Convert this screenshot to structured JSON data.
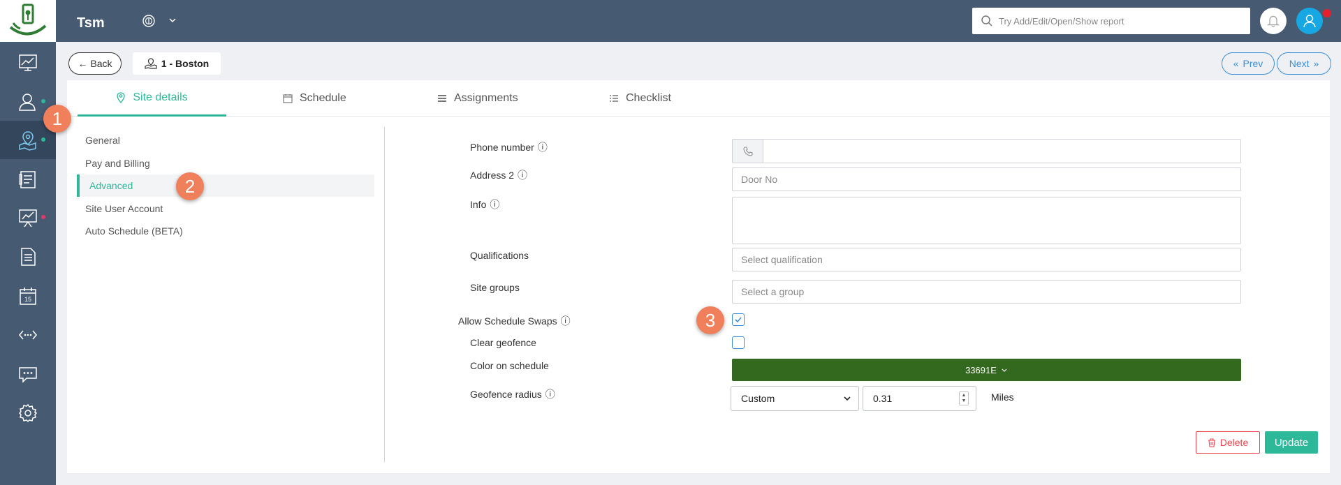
{
  "app": {
    "title": "Tsm"
  },
  "search": {
    "placeholder": "Try Add/Edit/Open/Show report"
  },
  "toolbar": {
    "back_label": "Back",
    "site_label": "1 - Boston",
    "prev_label": "Prev",
    "next_label": "Next"
  },
  "sidebar": {
    "items": [
      {
        "icon": "dashboard-chart-icon"
      },
      {
        "icon": "users-icon",
        "dot": "#2db89a"
      },
      {
        "icon": "sites-map-icon",
        "dot": "#2db89a",
        "active": true
      },
      {
        "icon": "schedule-board-icon"
      },
      {
        "icon": "reports-presentation-icon",
        "dot": "#e5396a"
      },
      {
        "icon": "document-icon"
      },
      {
        "icon": "calendar-icon",
        "text": "15"
      },
      {
        "icon": "integrations-icon"
      },
      {
        "icon": "messages-icon"
      },
      {
        "icon": "settings-gear-icon"
      }
    ]
  },
  "tabs": [
    {
      "label": "Site details",
      "active": true
    },
    {
      "label": "Schedule"
    },
    {
      "label": "Assignments"
    },
    {
      "label": "Checklist"
    }
  ],
  "subnav": [
    {
      "label": "General"
    },
    {
      "label": "Pay and Billing"
    },
    {
      "label": "Advanced",
      "active": true
    },
    {
      "label": "Site User Account"
    },
    {
      "label": "Auto Schedule (BETA)"
    }
  ],
  "form": {
    "phone": {
      "label": "Phone number",
      "value": ""
    },
    "address2": {
      "label": "Address 2",
      "placeholder": "Door No"
    },
    "info": {
      "label": "Info",
      "value": ""
    },
    "qualifications": {
      "label": "Qualifications",
      "placeholder": "Select qualification"
    },
    "site_groups": {
      "label": "Site groups",
      "placeholder": "Select a group"
    },
    "allow_swaps": {
      "label": "Allow Schedule Swaps",
      "checked": true
    },
    "clear_geofence": {
      "label": "Clear geofence",
      "checked": false
    },
    "color": {
      "label": "Color on schedule",
      "value": "33691E",
      "hex": "#33691e"
    },
    "geofence": {
      "label": "Geofence radius",
      "mode": "Custom",
      "value": "0.31",
      "unit": "Miles"
    }
  },
  "actions": {
    "delete_label": "Delete",
    "update_label": "Update"
  },
  "markers": [
    "1",
    "2",
    "3"
  ],
  "colors": {
    "accent": "#2db89a",
    "nav": "#465a72",
    "link": "#3a8fd6",
    "danger": "#e8434f"
  }
}
